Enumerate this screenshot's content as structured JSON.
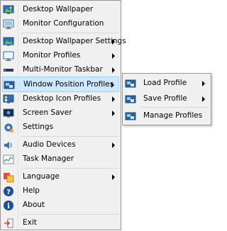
{
  "menu": {
    "items": [
      {
        "label": "Desktop Wallpaper",
        "icon": "desktop-wallpaper-icon"
      },
      {
        "label": "Monitor Configuration",
        "icon": "monitor-config-icon"
      },
      {
        "label": "Desktop Wallpaper Settings",
        "icon": "wallpaper-settings-icon"
      },
      {
        "label": "Monitor Profiles",
        "icon": "monitor-profiles-icon"
      },
      {
        "label": "Multi-Monitor Taskbar",
        "icon": "taskbar-icon"
      },
      {
        "label": "Window Position Profiles",
        "icon": "window-position-icon"
      },
      {
        "label": "Desktop Icon Profiles",
        "icon": "desktop-icon-profiles-icon"
      },
      {
        "label": "Screen Saver",
        "icon": "screen-saver-icon"
      },
      {
        "label": "Settings",
        "icon": "settings-gear-icon"
      },
      {
        "label": "Audio Devices",
        "icon": "speaker-icon"
      },
      {
        "label": "Task Manager",
        "icon": "task-manager-icon"
      },
      {
        "label": "Language",
        "icon": "language-icon"
      },
      {
        "label": "Help",
        "icon": "help-icon"
      },
      {
        "label": "About",
        "icon": "info-icon"
      },
      {
        "label": "Exit",
        "icon": "exit-icon"
      }
    ]
  },
  "submenu": {
    "items": [
      {
        "label": "Load Profile",
        "icon": "load-profile-icon"
      },
      {
        "label": "Save Profile",
        "icon": "save-profile-icon"
      },
      {
        "label": "Manage Profiles",
        "icon": "manage-profiles-icon"
      }
    ]
  },
  "colors": {
    "menu_bg": "#f0f0f0",
    "highlight_bg": "#cde8ff",
    "highlight_border": "#99d1ff",
    "separator": "#d7d7d7"
  }
}
